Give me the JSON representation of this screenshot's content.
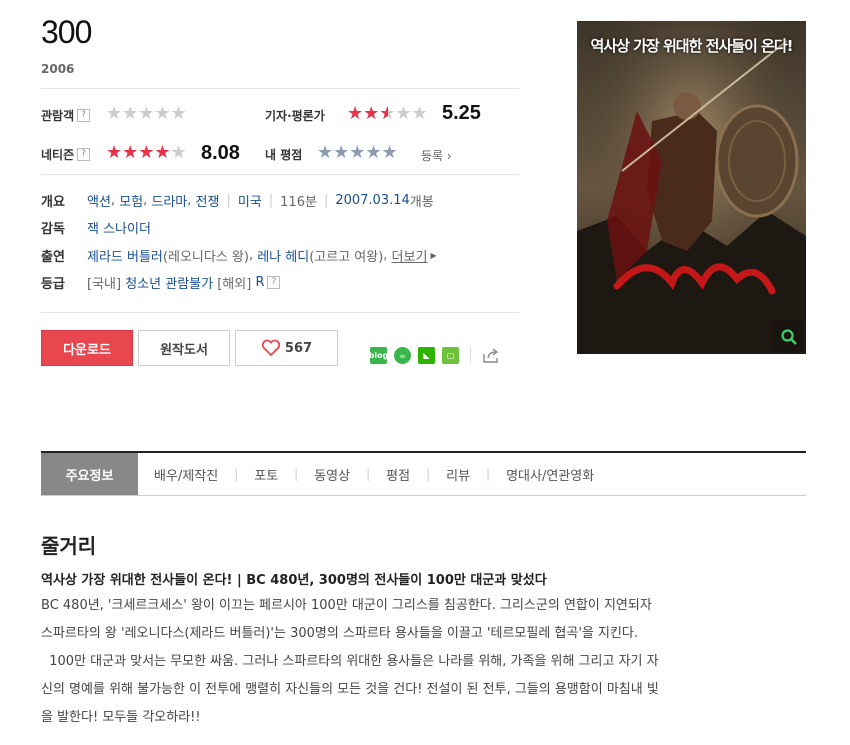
{
  "movie": {
    "title": "300",
    "year": "2006"
  },
  "ratings": {
    "audience_label": "관람객",
    "critic_label": "기자·평론가",
    "critic_score": "5.25",
    "critic_stars_fraction": 0.525,
    "netizen_label": "네티즌",
    "netizen_score": "8.08",
    "netizen_stars_fraction": 0.808,
    "my_label": "내 평점",
    "register_label": "등록",
    "help_mark": "?"
  },
  "info": {
    "genre_label": "개요",
    "genres": [
      "액션",
      "모험",
      "드라마",
      "전쟁"
    ],
    "country": "미국",
    "runtime": "116분",
    "release": "2007.03.14",
    "release_suffix": "개봉",
    "director_label": "감독",
    "director": "잭 스나이더",
    "cast_label": "출연",
    "cast1": "제라드 버틀러",
    "cast1_role": "(레오니다스 왕)",
    "cast2": "레나 헤디",
    "cast2_role": "(고르고 여왕)",
    "more": "더보기",
    "grade_label": "등급",
    "grade_domestic_prefix": "[국내]",
    "grade_domestic": "청소년 관람불가",
    "grade_overseas_prefix": "[해외]",
    "grade_overseas": "R"
  },
  "actions": {
    "download": "다운로드",
    "book": "원작도서",
    "likes": "567"
  },
  "poster": {
    "tagline": "역사상 가장 위대한 전사들이 온다!",
    "logo": "300"
  },
  "tabs": [
    "주요정보",
    "배우/제작진",
    "포토",
    "동영상",
    "평점",
    "리뷰",
    "명대사/연관영화"
  ],
  "story": {
    "heading": "줄거리",
    "subtitle": "역사상 가장 위대한 전사들이 온다! | BC 480년, 300명의 전사들이 100만 대군과 맞섰다",
    "line1": "BC 480년, '크세르크세스' 왕이 이끄는 페르시아 100만 대군이 그리스를 침공한다. 그리스군의 연합이 지연되자",
    "line2": "스파르타의 왕 '레오니다스(제라드 버틀러)'는 300명의 스파르타 용사들을 이끌고 '테르모필레 협곡'을 지킨다.",
    "line3": "  100만 대군과 맞서는 무모한 싸움. 그러나 스파르타의 위대한 용사들은 나라를 위해, 가족을 위해 그리고 자기 자",
    "line4": "신의 명예를 위해 불가능한 이 전투에 맹렬히 자신들의 모든 것을 건다! 전설이 된 전투, 그들의 용맹함이 마침내 빛",
    "line5": "을 발한다! 모두들 각오하라!!"
  },
  "colors": {
    "accent_red": "#e8474f",
    "link_blue": "#1a4f8f"
  }
}
